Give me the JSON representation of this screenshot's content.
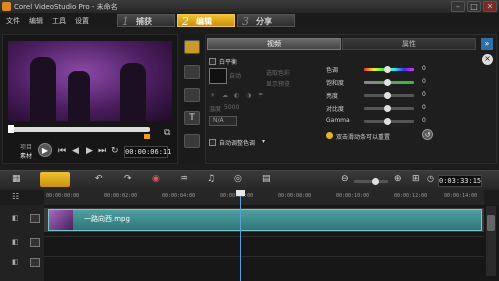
{
  "window": {
    "title": "Corel VideoStudio Pro - 未命名",
    "minimize": "–",
    "maximize": "□",
    "close": "✕"
  },
  "menu": {
    "items": [
      "文件",
      "编辑",
      "工具",
      "设置"
    ]
  },
  "steps": [
    {
      "num": "1",
      "label": "捕获"
    },
    {
      "num": "2",
      "label": "编辑"
    },
    {
      "num": "3",
      "label": "分享"
    }
  ],
  "preview": {
    "project_label": "项目",
    "clip_label": "素材",
    "timecode": "00:00:06:11"
  },
  "options": {
    "tabs": {
      "video": "视频",
      "attribute": "属性"
    },
    "white_balance": "白平衡",
    "wb_auto": "自动",
    "wb_pick": "选取色彩",
    "wb_show": "显示预览",
    "temperature": "温度",
    "temperature_value": "5000",
    "na_value": "N/A",
    "auto_tone": "自动调整色调",
    "adjust_labels": [
      "色调",
      "饱和度",
      "亮度",
      "对比度",
      "Gamma"
    ],
    "adjust_values": [
      "0",
      "0",
      "0",
      "0",
      "0"
    ],
    "reset_hint": "双击滑动条可以重置"
  },
  "timeline": {
    "timecode": "0:03:33:15",
    "ruler": [
      "00:00:00:00",
      "00:00:02:00",
      "00:00:04:00",
      "00:00:06:00",
      "00:00:08:00",
      "00:00:10:00",
      "00:00:12:00",
      "00:00:14:00"
    ],
    "clip_name": "一路向西.mpg"
  }
}
